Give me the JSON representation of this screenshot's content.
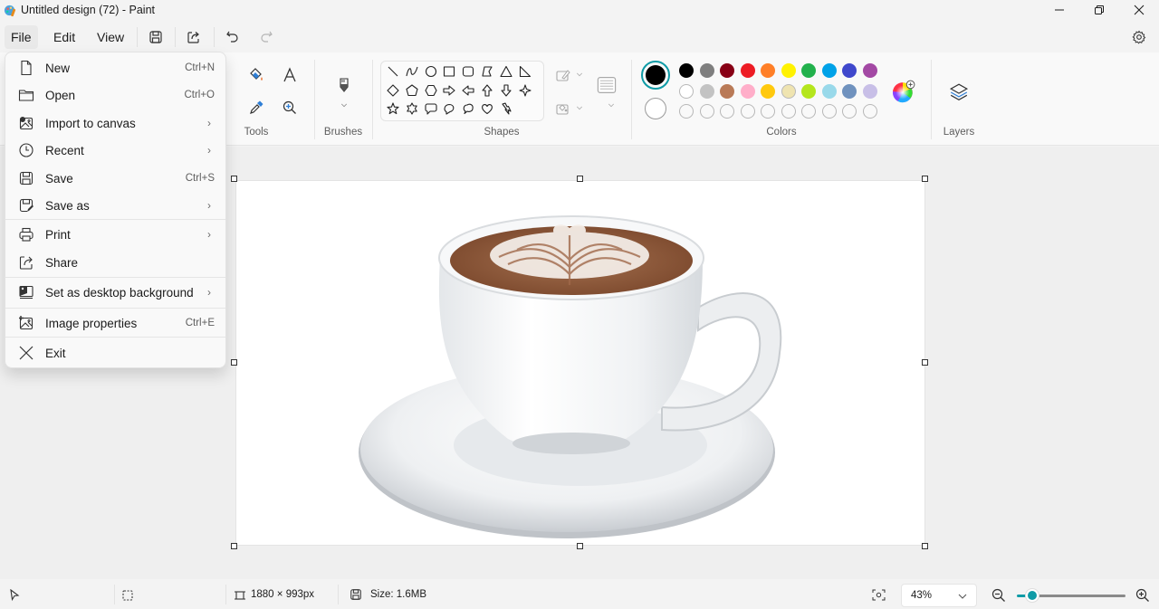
{
  "window": {
    "title": "Untitled design (72) - Paint"
  },
  "menubar": {
    "items": [
      "File",
      "Edit",
      "View"
    ],
    "active": "File"
  },
  "ribbon": {
    "groups": {
      "tools": "Tools",
      "brushes": "Brushes",
      "shapes": "Shapes",
      "colors": "Colors",
      "layers": "Layers"
    },
    "primary_color": "#000000",
    "secondary_color": "#ffffff",
    "palette_row1": [
      "#000000",
      "#7f7f7f",
      "#880015",
      "#ed1c24",
      "#ff7f27",
      "#fff200",
      "#22b14c",
      "#00a2e8",
      "#3f48cc",
      "#a349a4"
    ],
    "palette_row2": [
      "#ffffff",
      "#c3c3c3",
      "#b97a57",
      "#ffaec9",
      "#ffc90e",
      "#efe4b0",
      "#b5e61d",
      "#99d9ea",
      "#7092be",
      "#c8bfe7"
    ],
    "palette_row3_empty_slots": 10,
    "shapes": [
      "line",
      "curve",
      "oval",
      "rectangle",
      "rounded-rectangle",
      "polygon",
      "triangle",
      "right-triangle",
      "diamond",
      "pentagon",
      "hexagon",
      "right-arrow",
      "left-arrow",
      "up-arrow",
      "down-arrow",
      "four-point-star",
      "five-point-star",
      "six-point-star",
      "rounded-callout",
      "oval-callout",
      "cloud-callout",
      "heart",
      "lightning"
    ]
  },
  "file_menu": {
    "items": [
      {
        "label": "New",
        "shortcut": "Ctrl+N",
        "submenu": false,
        "icon": "new-file-icon"
      },
      {
        "label": "Open",
        "shortcut": "Ctrl+O",
        "submenu": false,
        "icon": "folder-icon"
      },
      {
        "label": "Import to canvas",
        "shortcut": "",
        "submenu": true,
        "icon": "import-image-icon"
      },
      {
        "label": "Recent",
        "shortcut": "",
        "submenu": true,
        "icon": "clock-icon"
      },
      {
        "label": "Save",
        "shortcut": "Ctrl+S",
        "submenu": false,
        "icon": "save-icon"
      },
      {
        "label": "Save as",
        "shortcut": "",
        "submenu": true,
        "icon": "save-as-icon"
      },
      {
        "label": "Print",
        "shortcut": "",
        "submenu": true,
        "icon": "printer-icon"
      },
      {
        "label": "Share",
        "shortcut": "",
        "submenu": false,
        "icon": "share-icon"
      },
      {
        "label": "Set as desktop background",
        "shortcut": "",
        "submenu": true,
        "icon": "desktop-background-icon"
      },
      {
        "label": "Image properties",
        "shortcut": "Ctrl+E",
        "submenu": false,
        "icon": "image-properties-icon"
      },
      {
        "label": "Exit",
        "shortcut": "",
        "submenu": false,
        "icon": "close-icon"
      }
    ],
    "chevron": "›"
  },
  "canvas": {
    "image_subject": "Latte art coffee cup on saucer"
  },
  "statusbar": {
    "dimensions": "1880 × 993px",
    "size": "Size: 1.6MB",
    "zoom": "43%",
    "zoom_fraction": 0.08
  }
}
